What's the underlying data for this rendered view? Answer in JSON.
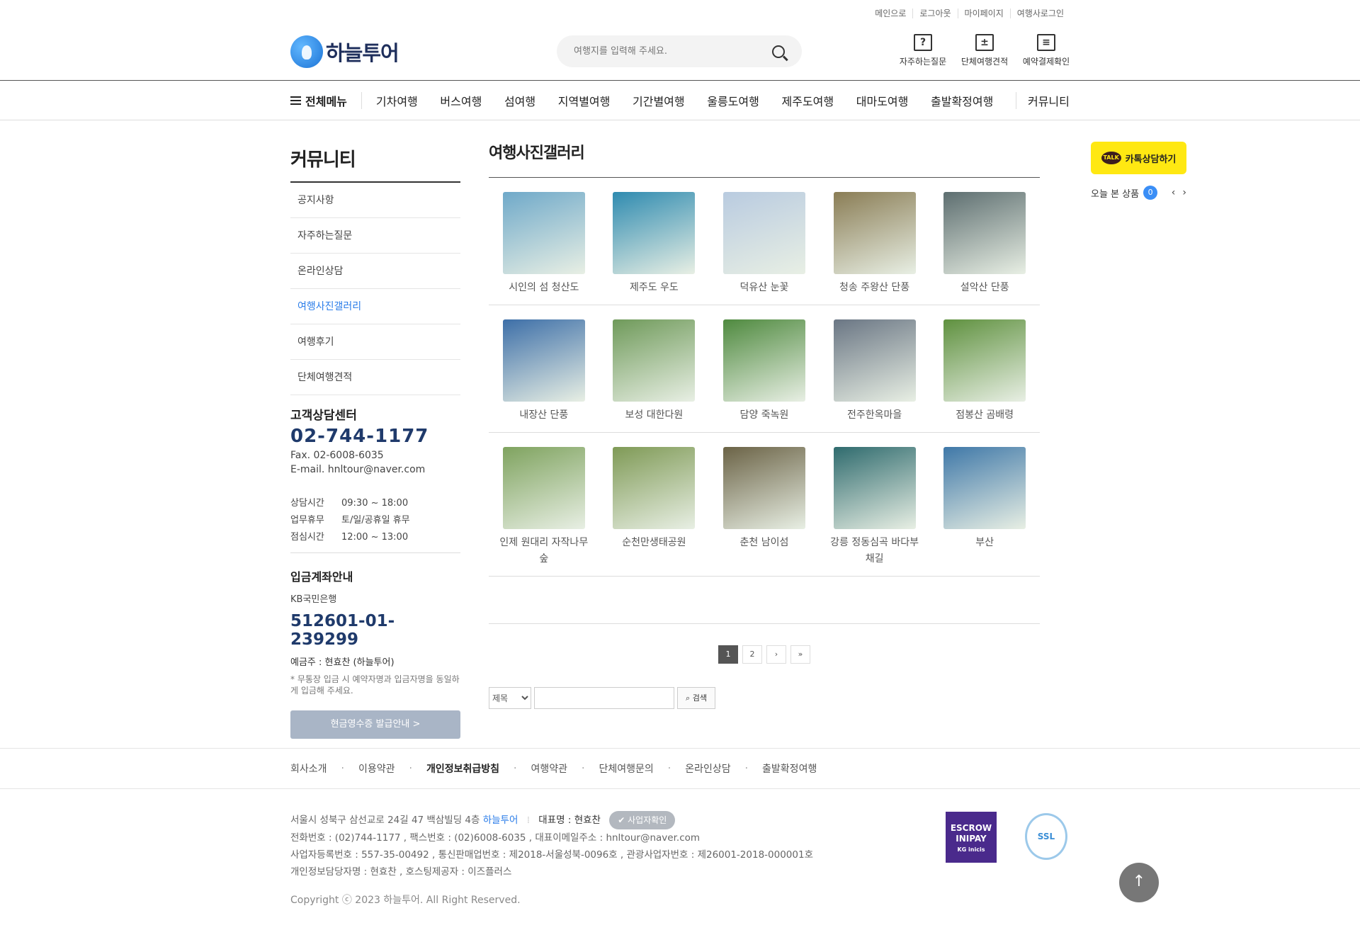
{
  "util_links": [
    "메인으로",
    "로그아웃",
    "마이페이지",
    "여행사로그인"
  ],
  "logo_text": "하늘투어",
  "search": {
    "placeholder": "여행지를 입력해 주세요."
  },
  "quick_links": [
    {
      "label": "자주하는질문",
      "icon": "question-icon",
      "glyph": "?"
    },
    {
      "label": "단체여행견적",
      "icon": "calculator-icon",
      "glyph": "±"
    },
    {
      "label": "예약결제확인",
      "icon": "monitor-icon",
      "glyph": "≡"
    }
  ],
  "gnb": {
    "all_menu": "전체메뉴",
    "items": [
      "기차여행",
      "버스여행",
      "섬여행",
      "지역별여행",
      "기간별여행",
      "울릉도여행",
      "제주도여행",
      "대마도여행",
      "출발확정여행",
      "커뮤니티"
    ]
  },
  "sidebar": {
    "title": "커뮤니티",
    "items": [
      "공지사항",
      "자주하는질문",
      "온라인상담",
      "여행사진갤러리",
      "여행후기",
      "단체여행견적"
    ],
    "active_index": 3
  },
  "cs": {
    "title": "고객상담센터",
    "phone": "02-744-1177",
    "fax": "Fax. 02-6008-6035",
    "email": "E-mail. hnltour@naver.com",
    "hours": [
      {
        "label": "상담시간",
        "value": "09:30 ~ 18:00"
      },
      {
        "label": "업무휴무",
        "value": "토/일/공휴일 휴무"
      },
      {
        "label": "점심시간",
        "value": "12:00 ~ 13:00"
      }
    ]
  },
  "bank": {
    "title": "입금계좌안내",
    "name": "KB국민은행",
    "account": "512601-01-239299",
    "owner": "예금주 : 현효찬 (하늘투어)",
    "note": "* 무통장 입금 시 예약자명과 입금자명을 동일하게 입금해 주세요.",
    "receipt_button": "현금영수증 발급안내 >"
  },
  "content": {
    "title": "여행사진갤러리",
    "gallery_rows": [
      [
        {
          "caption": "시인의 섬 청산도",
          "color": "#6fa9c9"
        },
        {
          "caption": "제주도 우도",
          "color": "#2f8bb0"
        },
        {
          "caption": "덕유산 눈꽃",
          "color": "#b9cbe0"
        },
        {
          "caption": "청송 주왕산 단풍",
          "color": "#8a7d55"
        },
        {
          "caption": "설악산 단풍",
          "color": "#5d6e70"
        }
      ],
      [
        {
          "caption": "내장산 단풍",
          "color": "#3d6fa8"
        },
        {
          "caption": "보성 대한다원",
          "color": "#6f9a5a"
        },
        {
          "caption": "담양 죽녹원",
          "color": "#4f8a3f"
        },
        {
          "caption": "전주한옥마을",
          "color": "#6a7684"
        },
        {
          "caption": "점봉산 곰배령",
          "color": "#5f913f"
        }
      ],
      [
        {
          "caption": "인제 원대리 자작나무숲",
          "color": "#7fa35f"
        },
        {
          "caption": "순천만생태공원",
          "color": "#7f9a56"
        },
        {
          "caption": "춘천 남이섬",
          "color": "#6b6346"
        },
        {
          "caption": "강릉 정동심곡 바다부채길",
          "color": "#2f6b6e"
        },
        {
          "caption": "부산",
          "color": "#3f78a8"
        }
      ]
    ]
  },
  "pager": {
    "pages": [
      "1",
      "2"
    ],
    "next": "›",
    "last": "»",
    "current": "1"
  },
  "board_search": {
    "field": "제목",
    "button": "검색"
  },
  "kakao": {
    "badge": "TALK",
    "label": "카톡상담하기"
  },
  "recent": {
    "label": "오늘 본 상품",
    "count": "0",
    "prev": "‹",
    "next": "›"
  },
  "footer_nav": [
    "회사소개",
    "이용약관",
    "개인정보취급방침",
    "여행약관",
    "단체여행문의",
    "온라인상담",
    "출발확정여행"
  ],
  "footer_info": {
    "address": "서울시 성북구 삼선교로 24길 47 백삼빌딩 4층",
    "company": "하늘투어",
    "ceo": "대표명 : 현효찬",
    "biz_button": "사업자확인",
    "contacts": "전화번호 : (02)744-1177 , 팩스번호 : (02)6008-6035 , 대표이메일주소 : hnltour@naver.com",
    "registration": "사업자등록번호 : 557-35-00492 , 통신판매업번호 : 제2018-서울성북-0096호 , 관광사업자번호 : 제26001-2018-000001호",
    "privacy": "개인정보담당자명 : 현효찬 , 호스팅제공자 : 이즈플러스",
    "copyright": "Copyright ⓒ 2023 하늘투어. All Right Reserved."
  },
  "badges": {
    "escrow": "ESCROW INIPAY",
    "escrow_sub": "KG inicis",
    "ssl": "SSL"
  },
  "colors": {
    "accent": "#2b7de9",
    "navy": "#1f3a6b",
    "kakao": "#ffe812"
  }
}
